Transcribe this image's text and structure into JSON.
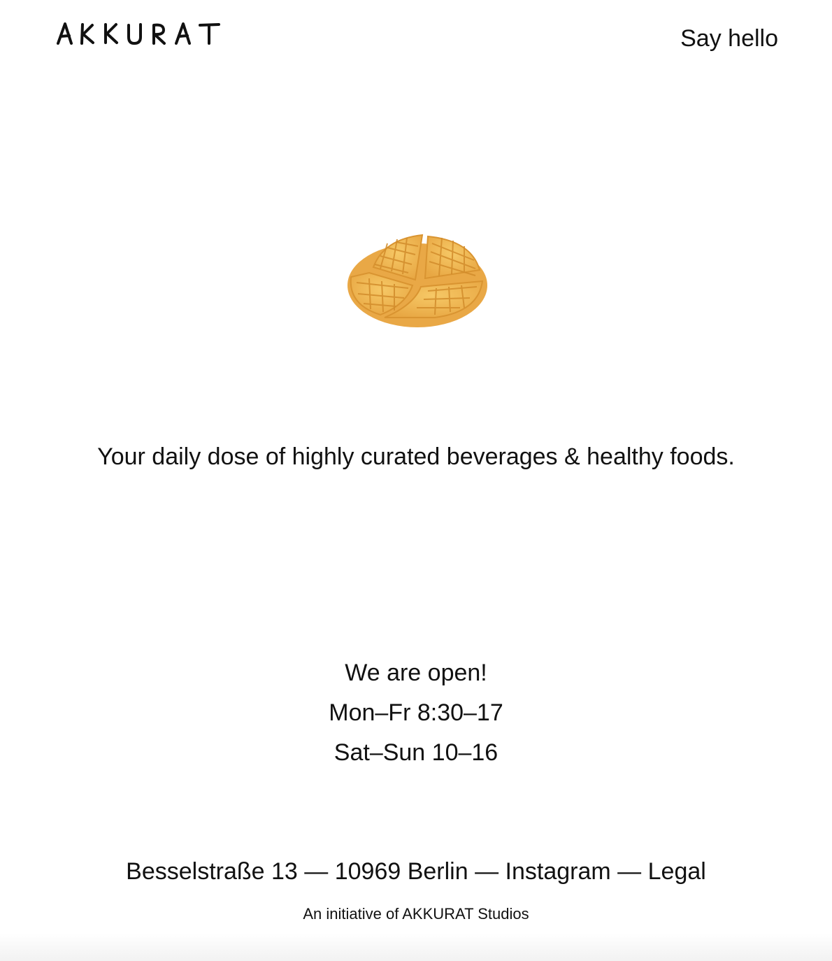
{
  "header": {
    "logo_text": "AKKURAT",
    "say_hello_label": "Say hello"
  },
  "hero": {
    "icon": "waffle-icon",
    "tagline": "Your daily dose of highly curated beverages & healthy foods."
  },
  "hours": {
    "heading": "We are open!",
    "weekdays": "Mon–Fr 8:30–17",
    "weekend": "Sat–Sun 10–16"
  },
  "footer": {
    "address": "Besselstraße 13",
    "city": "10969 Berlin",
    "separator": " — ",
    "instagram_label": "Instagram",
    "legal_label": "Legal",
    "initiative": "An initiative of AKKURAT Studios"
  },
  "colors": {
    "text": "#111111",
    "background": "#ffffff",
    "waffle": "#f0b853"
  }
}
